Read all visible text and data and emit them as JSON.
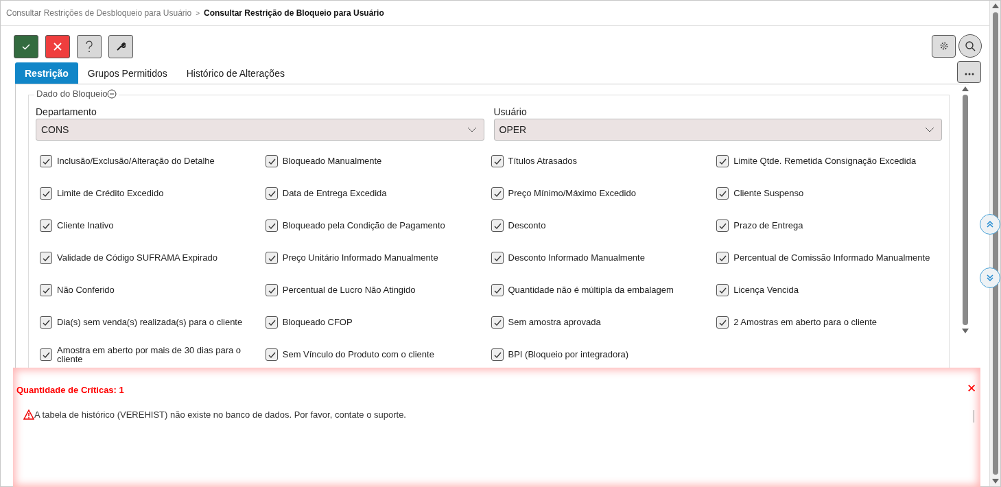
{
  "breadcrumb": {
    "parent": "Consultar Restrições de Desbloqueio para Usuário",
    "separator": ">",
    "current": "Consultar Restrição de Bloqueio para Usuário"
  },
  "tabs": [
    {
      "label": "Restrição",
      "selected": true
    },
    {
      "label": "Grupos Permitidos",
      "selected": false
    },
    {
      "label": "Histórico de Alterações",
      "selected": false
    }
  ],
  "section": {
    "title": "Dado do Bloqueio",
    "expanded": true
  },
  "fields": [
    {
      "label": "Departamento",
      "value": "CONS"
    },
    {
      "label": "Usuário",
      "value": "OPER"
    }
  ],
  "checkboxes": [
    {
      "label": "Inclusão/Exclusão/Alteração do Detalhe",
      "checked": true
    },
    {
      "label": "Bloqueado Manualmente",
      "checked": true
    },
    {
      "label": "Títulos Atrasados",
      "checked": true
    },
    {
      "label": "Limite Qtde. Remetida Consignação Excedida",
      "checked": true
    },
    {
      "label": "Limite de Crédito Excedido",
      "checked": true
    },
    {
      "label": "Data de Entrega Excedida",
      "checked": true
    },
    {
      "label": "Preço Mínimo/Máximo Excedido",
      "checked": true
    },
    {
      "label": "Cliente Suspenso",
      "checked": true
    },
    {
      "label": "Cliente Inativo",
      "checked": true
    },
    {
      "label": "Bloqueado pela Condição de Pagamento",
      "checked": true
    },
    {
      "label": "Desconto",
      "checked": true
    },
    {
      "label": "Prazo de Entrega",
      "checked": true
    },
    {
      "label": "Validade de Código SUFRAMA Expirado",
      "checked": true
    },
    {
      "label": "Preço Unitário Informado Manualmente",
      "checked": true
    },
    {
      "label": "Desconto Informado Manualmente",
      "checked": true
    },
    {
      "label": "Percentual de Comissão Informado Manualmente",
      "checked": true
    },
    {
      "label": "Não Conferido",
      "checked": true
    },
    {
      "label": "Percentual de Lucro Não Atingido",
      "checked": true
    },
    {
      "label": "Quantidade não é múltipla da embalagem",
      "checked": true
    },
    {
      "label": "Licença Vencida",
      "checked": true
    },
    {
      "label": "Dia(s) sem venda(s) realizada(s) para o cliente",
      "checked": true
    },
    {
      "label": "Bloqueado CFOP",
      "checked": true
    },
    {
      "label": "Sem amostra aprovada",
      "checked": true
    },
    {
      "label": "2 Amostras em aberto para o cliente",
      "checked": true
    },
    {
      "label": "Amostra em aberto por mais de 30 dias para o cliente",
      "checked": true
    },
    {
      "label": "Sem Vínculo do Produto com o cliente",
      "checked": true
    },
    {
      "label": "BPI (Bloqueio por integradora)",
      "checked": true
    }
  ],
  "errors": {
    "title": "Quantidade de Críticas: 1",
    "close": "✕",
    "messages": [
      "A tabela de histórico (VEREHIST) não existe no banco de dados. Por favor, contate o suporte."
    ]
  }
}
